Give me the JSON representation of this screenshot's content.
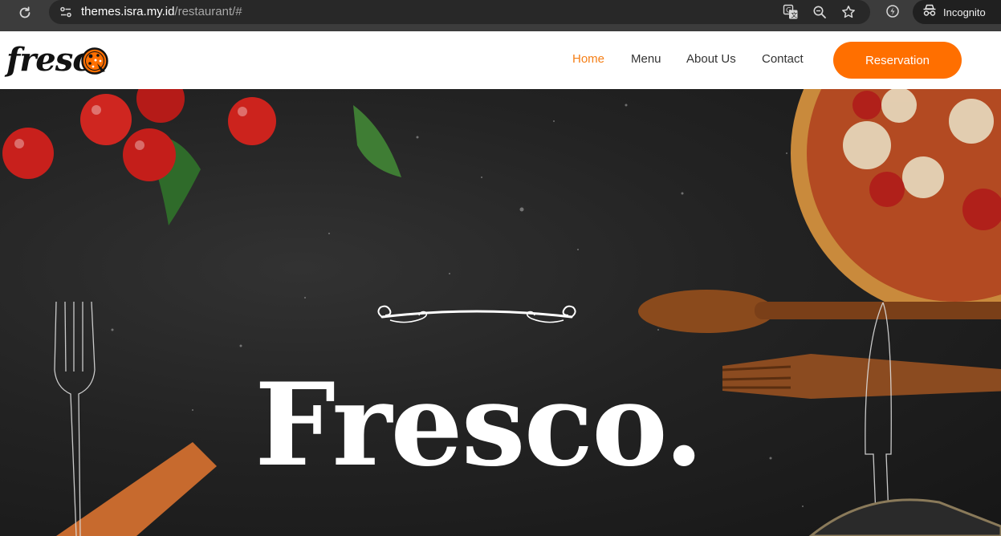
{
  "browser": {
    "url_host": "themes.isra.my.id",
    "url_path": "/restaurant/#",
    "incognito_label": "Incognito",
    "icons": [
      "reload-icon",
      "site-info-icon",
      "translate-icon",
      "zoom-icon",
      "bookmark-star-icon",
      "extension-icon",
      "incognito-icon"
    ]
  },
  "site": {
    "logo_text": "fresc",
    "nav": {
      "home": "Home",
      "menu": "Menu",
      "about": "About Us",
      "contact": "Contact"
    },
    "cta_label": "Reservation"
  },
  "hero": {
    "title": "Fresco."
  },
  "colors": {
    "accent": "#ff6f00",
    "active_nav": "#f57f17",
    "hero_bg": "#1c1c1c"
  }
}
